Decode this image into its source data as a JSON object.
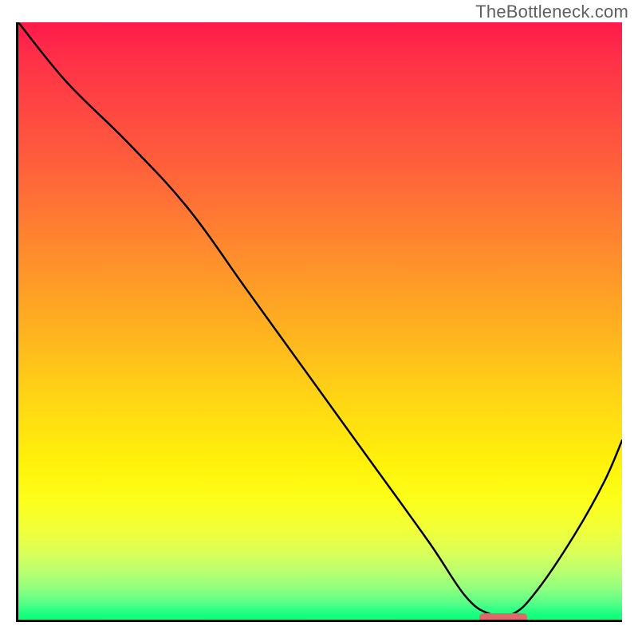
{
  "watermark": "TheBottleneck.com",
  "chart_data": {
    "type": "line",
    "title": "",
    "xlabel": "",
    "ylabel": "",
    "xlim": [
      0,
      100
    ],
    "ylim": [
      0,
      100
    ],
    "grid": false,
    "background": "red-yellow-green vertical gradient (high=red, low=green)",
    "series": [
      {
        "name": "bottleneck-curve",
        "x": [
          0,
          8,
          18,
          28,
          38,
          48,
          58,
          68,
          74,
          78,
          82,
          86,
          92,
          97,
          100
        ],
        "y": [
          100,
          90,
          80,
          69,
          55,
          41,
          27,
          13,
          4,
          1,
          1,
          5,
          14,
          23,
          30
        ]
      }
    ],
    "optimal_marker": {
      "x_start": 76,
      "x_end": 84,
      "y": 0.6
    },
    "gradient_stops": [
      {
        "pct": 0,
        "color": "#ff1a4b"
      },
      {
        "pct": 22,
        "color": "#ff5a3d"
      },
      {
        "pct": 52,
        "color": "#ffb31f"
      },
      {
        "pct": 74,
        "color": "#fff20a"
      },
      {
        "pct": 89,
        "color": "#d8ff5a"
      },
      {
        "pct": 100,
        "color": "#0cff78"
      }
    ]
  }
}
